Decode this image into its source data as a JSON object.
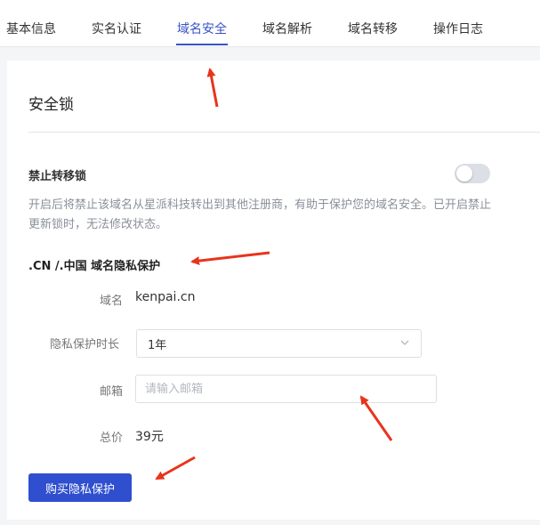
{
  "tabs": [
    {
      "label": "基本信息"
    },
    {
      "label": "实名认证"
    },
    {
      "label": "域名安全"
    },
    {
      "label": "域名解析"
    },
    {
      "label": "域名转移"
    },
    {
      "label": "操作日志"
    }
  ],
  "active_tab_index": 2,
  "section": {
    "title": "安全锁"
  },
  "transfer_lock": {
    "label": "禁止转移锁",
    "enabled": false,
    "description": "开启后将禁止该域名从星派科技转出到其他注册商，有助于保护您的域名安全。已开启禁止更新锁时，无法修改状态。"
  },
  "privacy": {
    "title": ".CN /.中国 域名隐私保护",
    "domain_label": "域名",
    "domain_value": "kenpai.cn",
    "duration_label": "隐私保护时长",
    "duration_value": "1年",
    "email_label": "邮箱",
    "email_placeholder": "请输入邮箱",
    "email_value": "",
    "price_label": "总价",
    "price_value": "39元",
    "buy_button": "购买隐私保护"
  },
  "colors": {
    "accent": "#3853c8",
    "button": "#2f4fcf",
    "annotation_arrow": "#e8341c"
  },
  "icons": {
    "select": "chevron-down-icon",
    "annotations": "red-arrow-icon"
  }
}
